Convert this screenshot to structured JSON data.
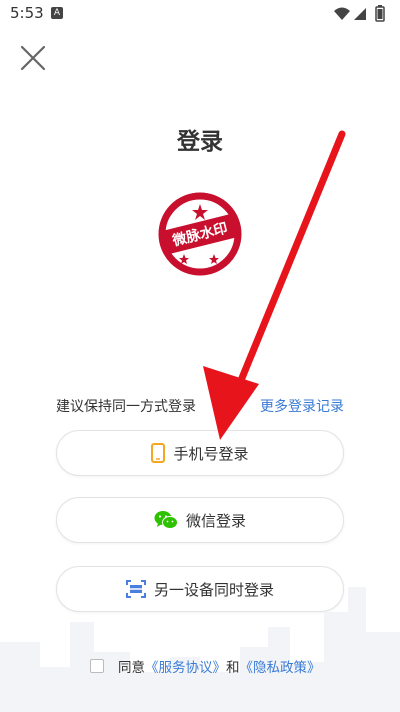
{
  "status_bar": {
    "time": "5:53",
    "notification_icon": "A"
  },
  "icons": {
    "close": "close-icon",
    "phone": "phone-icon",
    "wechat": "wechat-icon",
    "device": "scan-device-icon",
    "wifi": "wifi-icon",
    "signal": "signal-icon",
    "battery": "battery-icon"
  },
  "title": "登录",
  "watermark": {
    "text": "微脉水印"
  },
  "hint": "建议保持同一方式登录",
  "more_link": "更多登录记录",
  "buttons": {
    "phone": "手机号登录",
    "wechat": "微信登录",
    "device": "另一设备同时登录"
  },
  "agreement": {
    "prefix": "同意",
    "service": "《服务协议》",
    "and": "和",
    "privacy": "《隐私政策》"
  },
  "colors": {
    "accent": "#3a7bd5",
    "phone_icon": "#f5a623",
    "wechat_icon": "#2dc100",
    "device_icon": "#4a7fe0",
    "arrow": "#e8141b"
  }
}
